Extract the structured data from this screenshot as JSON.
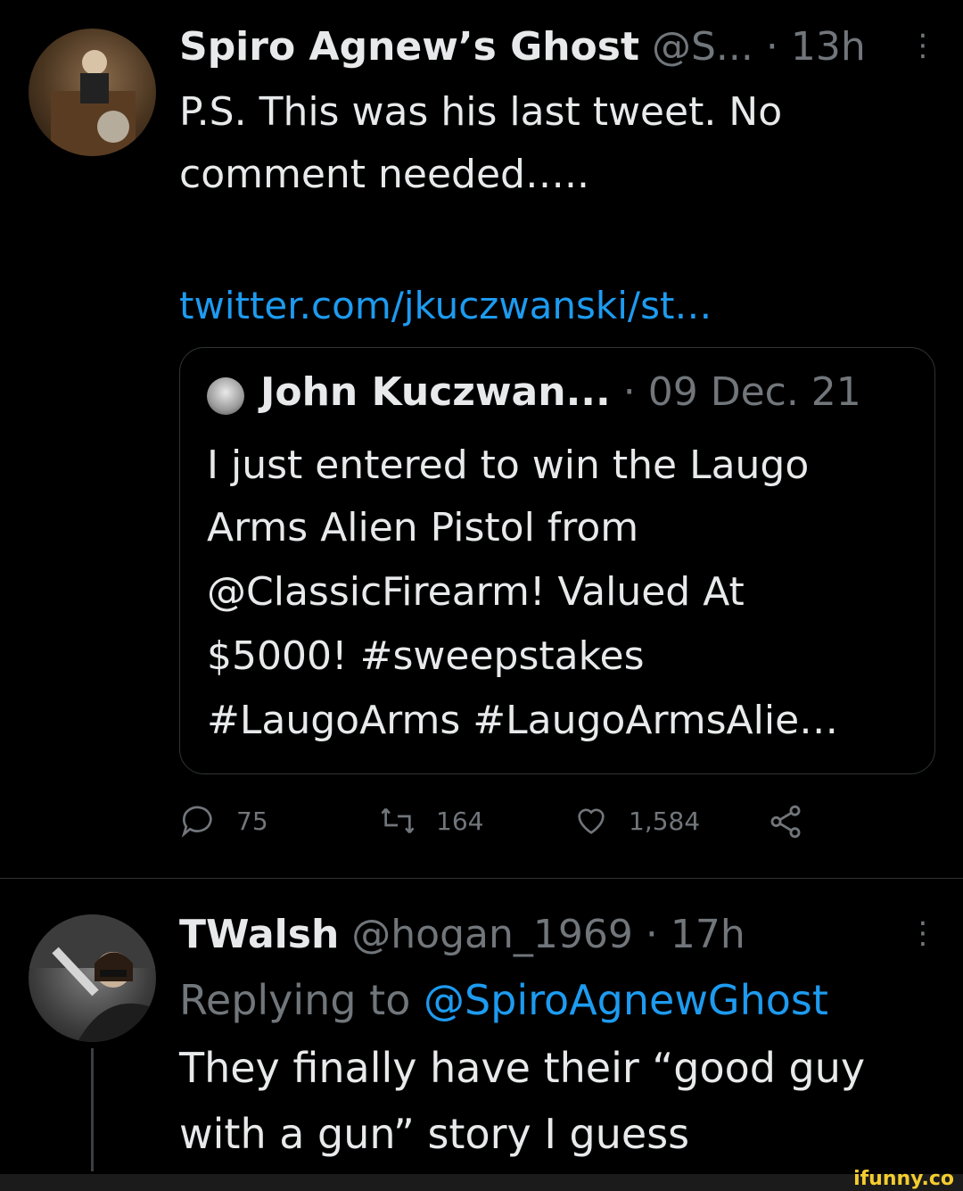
{
  "tweet1": {
    "display_name": "Spiro Agnew’s Ghost",
    "handle": "@S...",
    "separator": "·",
    "time": "13h",
    "text_line1": "P.S. This was his last tweet. No",
    "text_line2": "comment needed…..",
    "link": "twitter.com/jkuczwanski/st…"
  },
  "quoted": {
    "display_name": "John Kuczwan...",
    "separator": "·",
    "date": "09 Dec. 21",
    "line1": "I just entered to win the Laugo",
    "line2": "Arms Alien Pistol from",
    "line3": "@ClassicFirearm! Valued At",
    "line4": "$5000! #sweepstakes",
    "line5": "#LaugoArms #LaugoArmsAlie…"
  },
  "actions": {
    "reply_count": "75",
    "retweet_count": "164",
    "like_count": "1,584"
  },
  "tweet2": {
    "display_name": "TWalsh",
    "handle": "@hogan_1969",
    "separator": "·",
    "time": "17h",
    "replying_prefix": "Replying to",
    "replying_handle": "@SpiroAgnewGhost",
    "text_line1": "They finally have their “good guy",
    "text_line2": "with a gun” story I guess"
  },
  "watermark": "ifunny.co",
  "colors": {
    "background": "#000000",
    "text": "#e7e9ea",
    "muted": "#71767b",
    "link": "#1d9bf0",
    "border": "#2f3336"
  },
  "icons": [
    "reply-icon",
    "retweet-icon",
    "like-icon",
    "share-icon",
    "more-icon"
  ]
}
